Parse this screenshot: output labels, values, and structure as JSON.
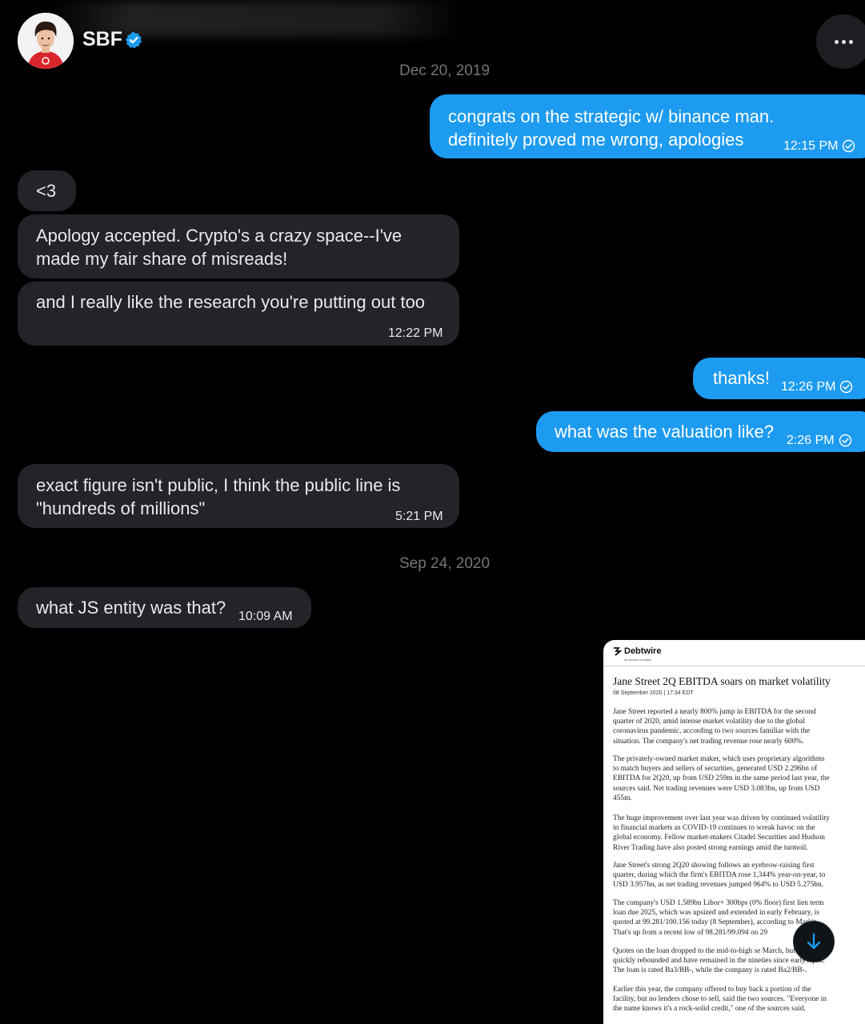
{
  "header": {
    "name": "SBF",
    "verified": true,
    "icons": {
      "avatar": "profile-avatar",
      "verified": "verified-badge-icon",
      "more": "more-horizontal-icon"
    }
  },
  "conversation": {
    "dates": [
      "Dec 20, 2019",
      "Sep 24, 2020"
    ],
    "messages": [
      {
        "from": "me",
        "text": "congrats on the strategic w/ binance man.\ndefinitely proved me wrong, apologies",
        "time": "12:15 PM",
        "read": true
      },
      {
        "from": "them",
        "text": "<3"
      },
      {
        "from": "them",
        "text": "Apology accepted.  Crypto's a crazy space--I've\nmade my fair share of misreads!"
      },
      {
        "from": "them",
        "text": "and I really like the research you're putting out too",
        "time": "12:22 PM"
      },
      {
        "from": "me",
        "text": "thanks!",
        "time": "12:26 PM",
        "read": true
      },
      {
        "from": "me",
        "text": "what was the valuation like?",
        "time": "2:26 PM",
        "read": true
      },
      {
        "from": "them",
        "text": "exact figure isn't public, I think the public line is\n\"hundreds of millions\"",
        "time": "5:21 PM"
      },
      {
        "from": "them",
        "text": "what JS entity was that?",
        "time": "10:09 AM"
      }
    ]
  },
  "attachment": {
    "brand": "Debtwire",
    "brand_sub": "An Acuris company",
    "headline": "Jane Street 2Q EBITDA soars on market volatility",
    "dateline": "08 September 2020 | 17:34 EDT",
    "paragraphs": [
      [
        "Jane Street reported a nearly 800% jump in EBITDA for the second",
        "quarter of 2020, amid intense market volatility due to the global",
        "coronavirus pandemic, according to two sources familiar with the",
        "situation. The company's net trading revenue rose nearly 600%."
      ],
      [
        "The privately-owned market maker, which uses proprietary algorithms",
        "to match buyers and sellers of securities, generated USD 2.296bn of",
        "EBITDA for 2Q20, up from USD 259m in the same period last year, the",
        "sources said. Net trading revenues were USD 3.083bn, up from USD",
        "455m."
      ],
      [
        "The huge improvement over last year was driven by continued volatility",
        "in financial markets as COVID-19 continues to wreak havoc on the",
        "global economy. Fellow market-makers Citadel Securities and Hudson",
        "River Trading have also posted strong earnings amid the turmoil."
      ],
      [
        "Jane Street's strong 2Q20 showing follows an eyebrow-raising first",
        "quarter, during which the firm's EBITDA rose 1,344% year-on-year, to",
        "USD 3.957bn, as net trading revenues jumped 964% to USD 5.275bn."
      ],
      [
        "The company's USD 1.589bn Libor+ 300bps (0% floor) first lien term",
        "loan due 2025, which was upsized and extended in early February, is",
        "quoted at 99.281/100.156 today (8 September), according to Markit.",
        "That's up from a recent low of 98.281/99.094 on 29"
      ],
      [
        "Quotes on the loan dropped to the mid-to-high se         March, but",
        "quickly rebounded and have remained in the nineties since early April.",
        "The loan is rated Ba3/BB-, while the company is rated Ba2/BB-."
      ],
      [
        "Earlier this year, the company offered to buy back a portion of the",
        "facility, but no lenders chose to sell, said the two sources. \"Everyone in",
        "the name knows it's a rock-solid credit,\" one of the sources said."
      ]
    ]
  },
  "controls": {
    "scroll_down_icon": "arrow-down-icon"
  },
  "colors": {
    "sent_bubble": "#1d9bf0",
    "received_bubble": "#232429",
    "background": "#000000",
    "date_text": "#71767b",
    "verified": "#1d9bf0"
  }
}
